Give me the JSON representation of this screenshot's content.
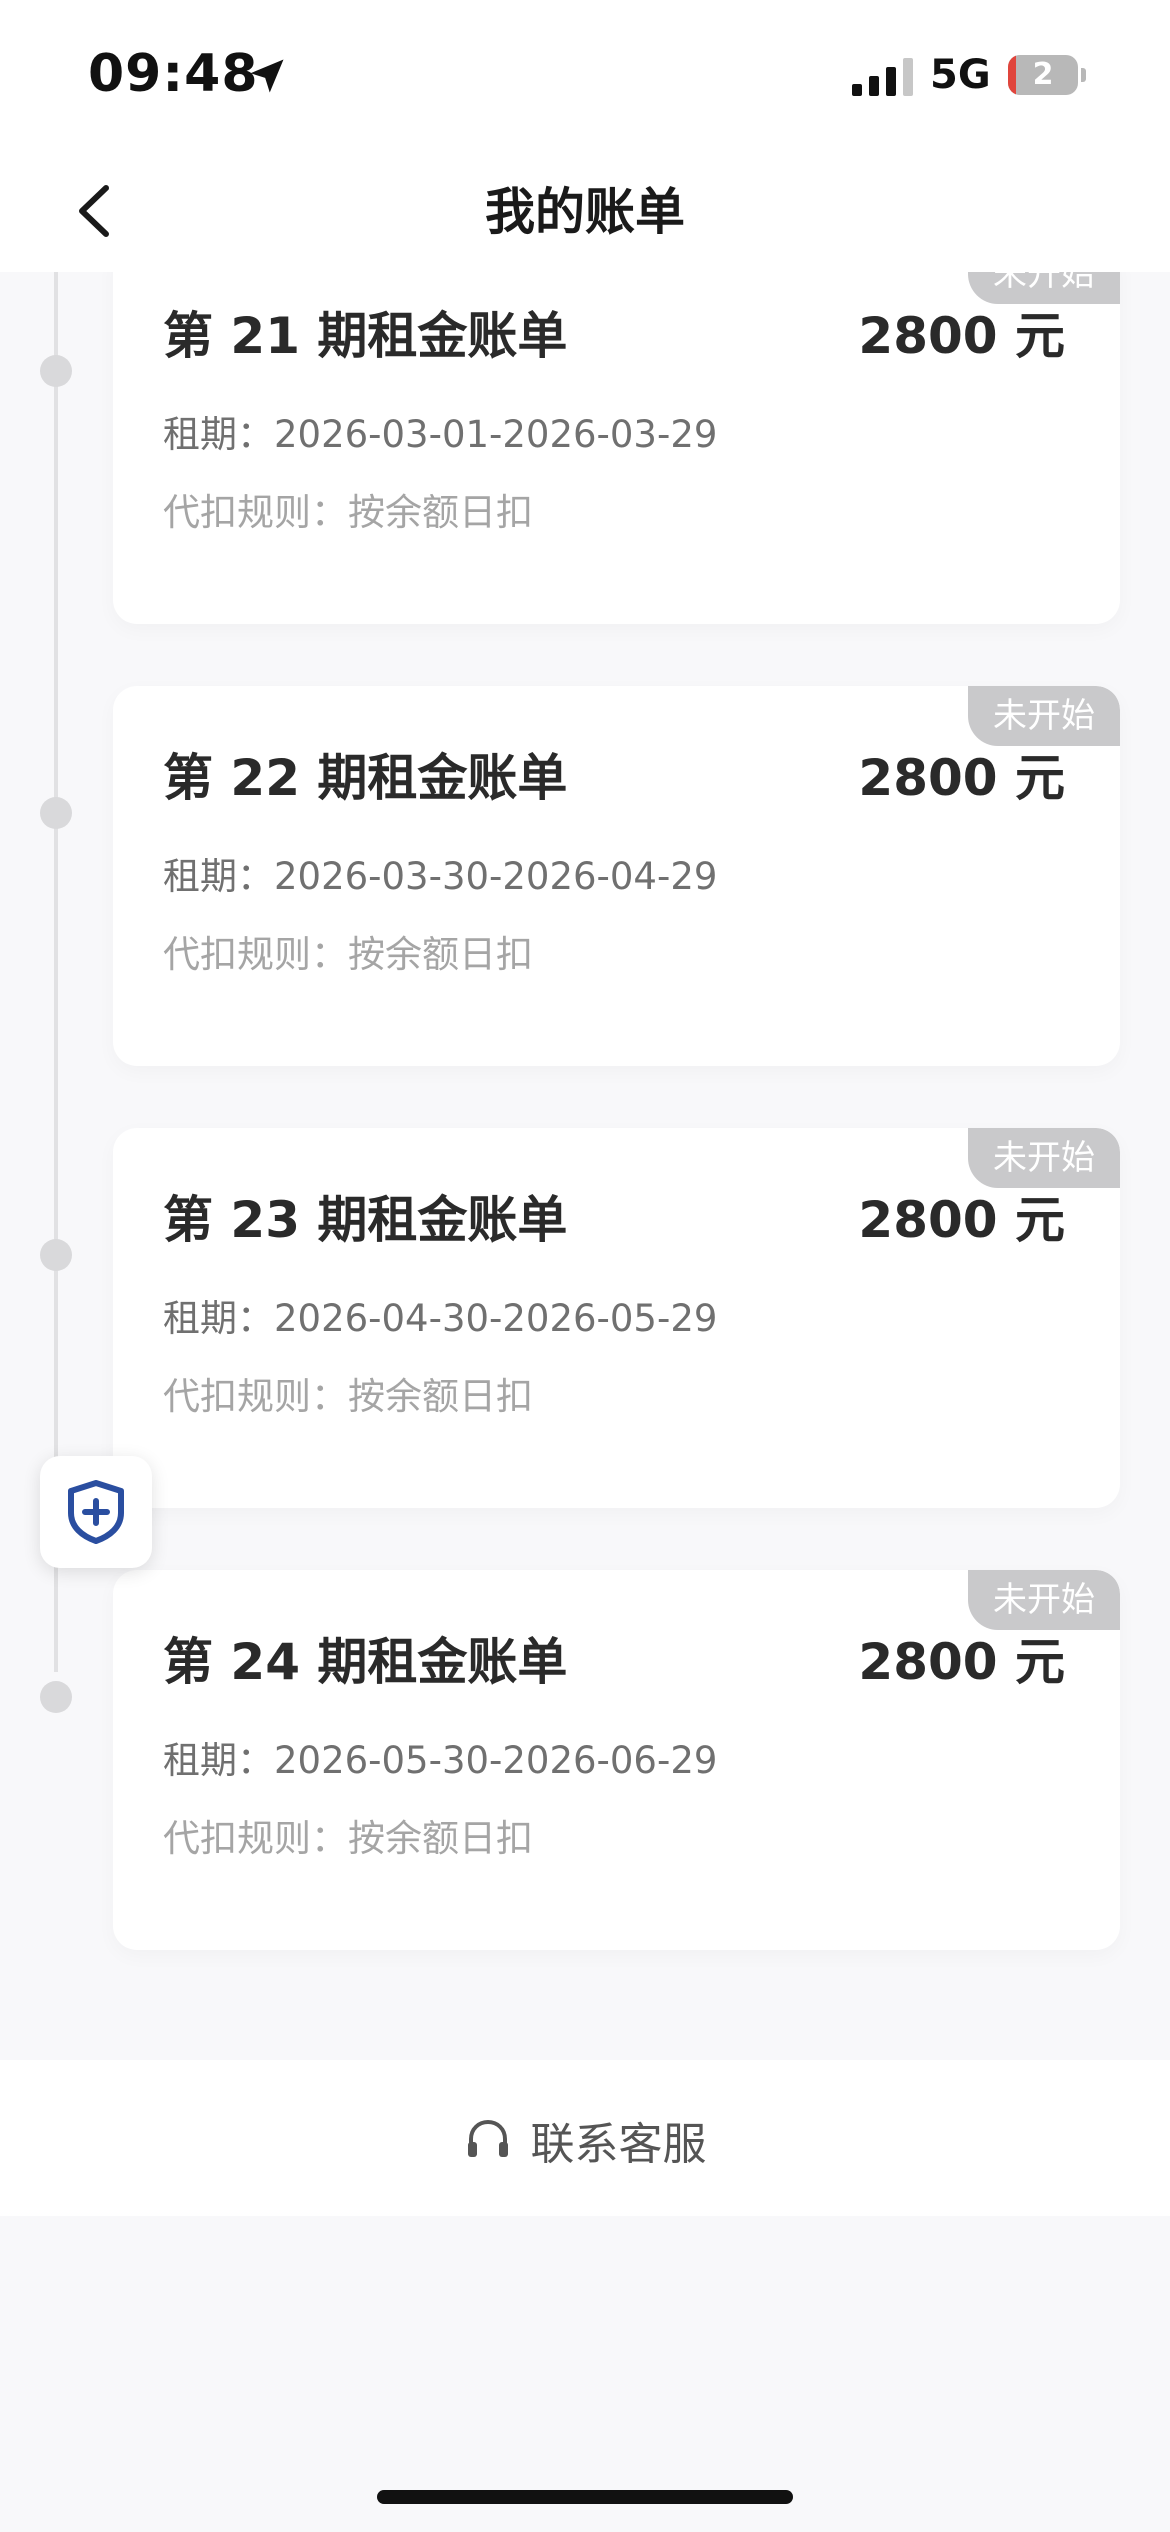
{
  "status_bar": {
    "time": "09:48",
    "network": "5G",
    "battery_level": "2"
  },
  "nav": {
    "title": "我的账单",
    "back_icon": "chevron-left-icon"
  },
  "bills": [
    {
      "badge": "未开始",
      "title": "第 21 期租金账单",
      "amount": "2800 元",
      "period": "租期：2026-03-01-2026-03-29",
      "rule": "代扣规则：按余额日扣"
    },
    {
      "badge": "未开始",
      "title": "第 22 期租金账单",
      "amount": "2800 元",
      "period": "租期：2026-03-30-2026-04-29",
      "rule": "代扣规则：按余额日扣"
    },
    {
      "badge": "未开始",
      "title": "第 23 期租金账单",
      "amount": "2800 元",
      "period": "租期：2026-04-30-2026-05-29",
      "rule": "代扣规则：按余额日扣"
    },
    {
      "badge": "未开始",
      "title": "第 24 期租金账单",
      "amount": "2800 元",
      "period": "租期：2026-05-30-2026-06-29",
      "rule": "代扣规则：按余额日扣"
    }
  ],
  "float_button_icon": "shield-plus-icon",
  "contact": {
    "label": "联系客服",
    "icon": "headset-icon"
  },
  "colors": {
    "badge_bg": "#c9c9cb",
    "shield_blue": "#2a4ea0"
  }
}
